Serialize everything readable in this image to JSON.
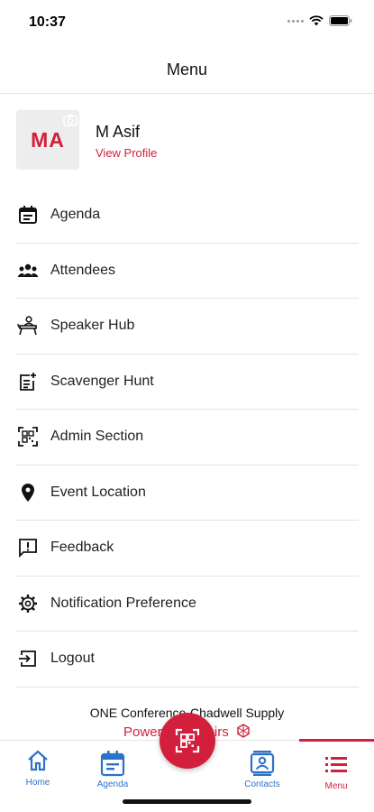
{
  "status_bar": {
    "time": "10:37"
  },
  "header": {
    "title": "Menu"
  },
  "profile": {
    "initials": "MA",
    "name": "M Asif",
    "link": "View Profile"
  },
  "menu": [
    {
      "label": "Agenda",
      "icon": "calendar-icon"
    },
    {
      "label": "Attendees",
      "icon": "people-icon"
    },
    {
      "label": "Speaker Hub",
      "icon": "speaker-icon"
    },
    {
      "label": "Scavenger Hunt",
      "icon": "note-add-icon"
    },
    {
      "label": "Admin Section",
      "icon": "qr-scan-icon"
    },
    {
      "label": "Event Location",
      "icon": "location-pin-icon"
    },
    {
      "label": "Feedback",
      "icon": "feedback-icon"
    },
    {
      "label": "Notification Preference",
      "icon": "gear-icon"
    },
    {
      "label": "Logout",
      "icon": "logout-icon"
    }
  ],
  "footer": {
    "conference": "ONE Conference-Chadwell Supply",
    "powered": "Powered by Fairs"
  },
  "tabs": [
    {
      "label": "Home",
      "icon": "home-icon"
    },
    {
      "label": "Agenda",
      "icon": "calendar-icon"
    },
    {
      "label": "Contacts",
      "icon": "contacts-icon"
    },
    {
      "label": "Menu",
      "icon": "list-icon",
      "active": true
    }
  ],
  "colors": {
    "accent": "#d21f3c",
    "tab_blue": "#2d72c9"
  }
}
